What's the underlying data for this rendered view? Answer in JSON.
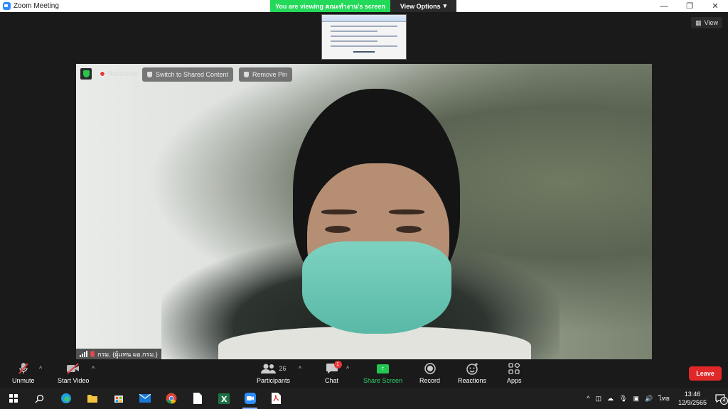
{
  "window": {
    "title": "Zoom Meeting"
  },
  "banner": {
    "viewing_text": "You are viewing คณะทำงาน's screen",
    "view_options_label": "View Options"
  },
  "view_button": {
    "label": "View"
  },
  "video": {
    "recording_label": "Recording",
    "switch_shared_label": "Switch to Shared Content",
    "remove_pin_label": "Remove Pin",
    "participant_name": "กรม. (ผู้แทน ผอ.กรม.)"
  },
  "toolbar": {
    "unmute_label": "Unmute",
    "start_video_label": "Start Video",
    "participants_label": "Participants",
    "participants_count": "26",
    "chat_label": "Chat",
    "chat_badge": "1",
    "share_label": "Share Screen",
    "record_label": "Record",
    "reactions_label": "Reactions",
    "apps_label": "Apps",
    "leave_label": "Leave"
  },
  "taskbar": {
    "language": "ไทย",
    "time": "13:46",
    "date": "12/9/2565",
    "notification_count": "4"
  },
  "colors": {
    "share_green": "#23c552",
    "leave_red": "#e02828",
    "banner_green": "#23d959"
  }
}
